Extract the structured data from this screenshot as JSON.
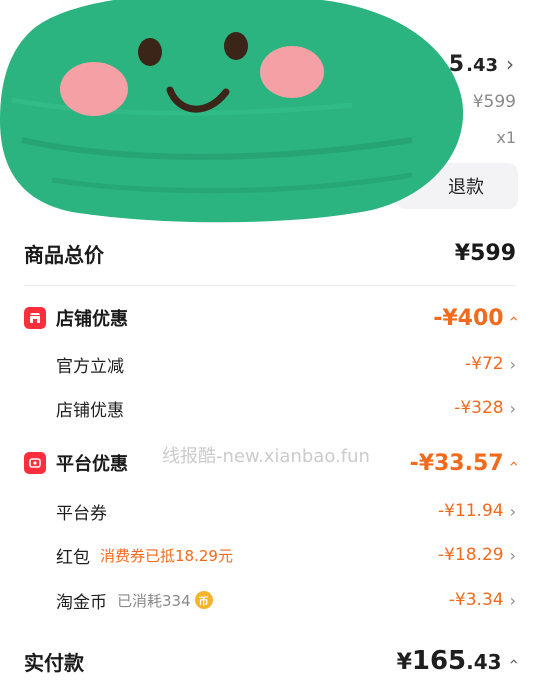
{
  "top": {
    "price_int": "5",
    "price_dec": ".43",
    "orig_price": "¥599",
    "qty": "x1",
    "refund_label": "退款"
  },
  "summary": {
    "goods_total_label": "商品总价",
    "goods_total_value": "¥599",
    "shop_discount": {
      "label": "店铺优惠",
      "value": "-¥400",
      "items": [
        {
          "label": "官方立减",
          "value": "-¥72"
        },
        {
          "label": "店铺优惠",
          "value": "-¥328"
        }
      ]
    },
    "platform_discount": {
      "label": "平台优惠",
      "value": "-¥33.57",
      "items": [
        {
          "label": "平台券",
          "value": "-¥11.94",
          "note": ""
        },
        {
          "label": "红包",
          "value": "-¥18.29",
          "note": "消费券已抵18.29元"
        },
        {
          "label": "淘金币",
          "value": "-¥3.34",
          "note": "已消耗334",
          "coin": "币"
        }
      ]
    },
    "paid_label": "实付款",
    "paid_currency": "¥",
    "paid_int": "165",
    "paid_dec": ".43"
  },
  "watermark": "线报酷-new.xianbao.fun",
  "colors": {
    "discount": "#f26a1b",
    "badge": "#ff2e3d",
    "sticker": "#2bb380"
  }
}
